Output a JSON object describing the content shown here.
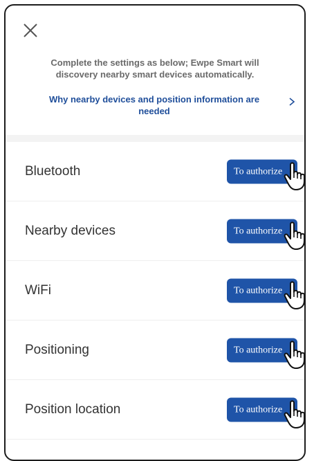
{
  "intro_text": "Complete the settings as below; Ewpe Smart will discovery nearby smart devices automatically.",
  "why_link_text": "Why nearby devices and position information are needed",
  "permissions": [
    {
      "label": "Bluetooth",
      "button": "To authorize"
    },
    {
      "label": "Nearby devices",
      "button": "To authorize"
    },
    {
      "label": "WiFi",
      "button": "To authorize"
    },
    {
      "label": "Positioning",
      "button": "To authorize"
    },
    {
      "label": "Position location",
      "button": "To authorize"
    }
  ],
  "icons": {
    "close": "close-icon",
    "chevron": "chevron-right-icon",
    "pointer": "hand-pointer-icon"
  },
  "colors": {
    "accent": "#1f54a8",
    "link": "#1f4e9a",
    "text": "#333333",
    "muted": "#6a6a6a"
  }
}
